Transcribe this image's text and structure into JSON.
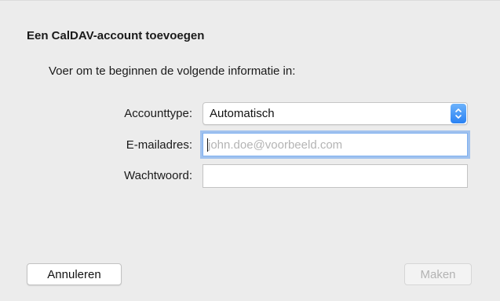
{
  "dialog": {
    "title": "Een CalDAV-account toevoegen",
    "intro": "Voer om te beginnen de volgende informatie in:",
    "fields": {
      "account_type": {
        "label": "Accounttype:",
        "selected_value": "Automatisch"
      },
      "email": {
        "label": "E-mailadres:",
        "value": "",
        "placeholder": "john.doe@voorbeeld.com"
      },
      "password": {
        "label": "Wachtwoord:",
        "value": ""
      }
    },
    "buttons": {
      "cancel_label": "Annuleren",
      "create_label": "Maken"
    }
  },
  "icons": {
    "select_stepper": "up-down-chevron-icon"
  },
  "colors": {
    "accent": "#2a82f3",
    "focus_ring": "#64a0f0",
    "background": "#ececec"
  }
}
